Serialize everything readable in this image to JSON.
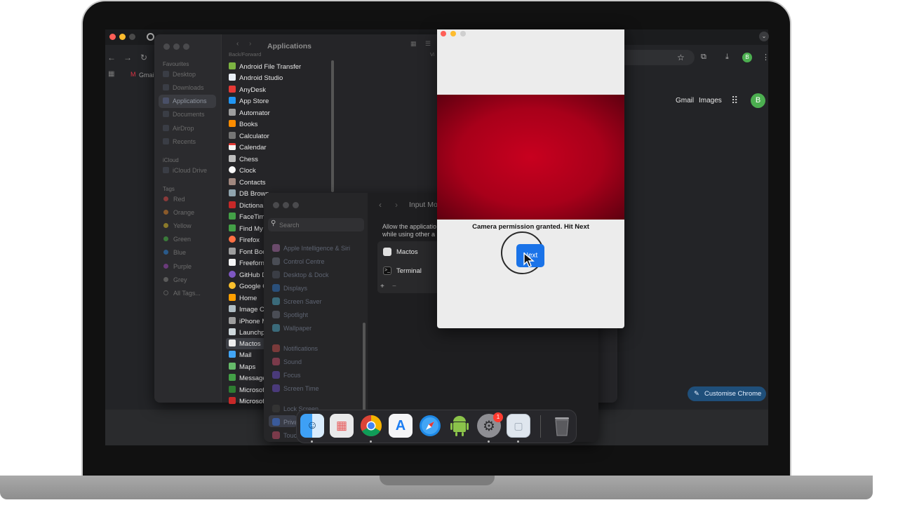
{
  "chrome": {
    "toolbar_links": [
      "Gmail",
      "Images"
    ],
    "tab_label": "Gmai",
    "avatar_letter": "B",
    "customise_label": "Customise Chrome"
  },
  "finder": {
    "title": "Applications",
    "nav_caption": "Back/Forward",
    "view_caption": "Vi",
    "sidebar_sections": {
      "favourites_label": "Favourites",
      "favourites": [
        "Desktop",
        "Downloads",
        "Applications",
        "Documents",
        "AirDrop",
        "Recents"
      ],
      "icloud_label": "iCloud",
      "icloud": [
        "iCloud Drive"
      ],
      "tags_label": "Tags",
      "tags": [
        "Red",
        "Orange",
        "Yellow",
        "Green",
        "Blue",
        "Purple",
        "Grey",
        "All Tags..."
      ]
    },
    "apps": [
      "Android File Transfer",
      "Android Studio",
      "AnyDesk",
      "App Store",
      "Automator",
      "Books",
      "Calculator",
      "Calendar",
      "Chess",
      "Clock",
      "Contacts",
      "DB Browser for SQLite",
      "Dictionary",
      "FaceTime",
      "Find My",
      "Firefox",
      "Font Book",
      "Freeform",
      "GitHub Desktop",
      "Google Chrome",
      "Home",
      "Image Capture",
      "iPhone Mirroring",
      "Launchpad",
      "Mactos",
      "Mail",
      "Maps",
      "Messages",
      "Microsoft",
      "Microsoft"
    ],
    "apps_visible": [
      "Android File Transfer",
      "Android Studio",
      "AnyDesk",
      "App Store",
      "Automator",
      "Books",
      "Calculator",
      "Calendar",
      "Chess",
      "Clock",
      "Contacts",
      "DB Brows",
      "Dictiona",
      "FaceTim",
      "Find My",
      "Firefox",
      "Font Boo",
      "Freeforn",
      "GitHub D",
      "Google C",
      "Home",
      "Image C",
      "iPhone M",
      "Launchp",
      "Mactos",
      "Mail",
      "Maps",
      "Message",
      "Microsof",
      "Microsof"
    ],
    "selected_app": "Mactos"
  },
  "settings": {
    "search_placeholder": "Search",
    "pane_title": "Input Mo",
    "description_line1": "Allow the applicatio",
    "description_line2": "while using other a",
    "items": [
      "Apple Intelligence & Siri",
      "Control Centre",
      "Desktop & Dock",
      "Displays",
      "Screen Saver",
      "Spotlight",
      "Wallpaper",
      "Notifications",
      "Sound",
      "Focus",
      "Screen Time",
      "Lock Screen",
      "Priva",
      "Touc"
    ],
    "apps_list": [
      "Mactos",
      "Terminal"
    ],
    "add_label": "+",
    "remove_label": "−"
  },
  "dialog": {
    "message": "Camera permission granted. Hit Next",
    "button_label": "Next"
  },
  "dock": {
    "apps": [
      "finder-icon",
      "launchpad-icon",
      "chrome-icon",
      "app-store-icon",
      "safari-icon",
      "android-studio-icon",
      "system-settings-icon",
      "preview-icon",
      "trash-icon"
    ],
    "settings_badge": "1"
  },
  "colors": {
    "chrome_accent": "#1f4f7a",
    "next_button": "#1a73e8",
    "camera_red": "#b3001b",
    "avatar_green": "#4caf50"
  }
}
